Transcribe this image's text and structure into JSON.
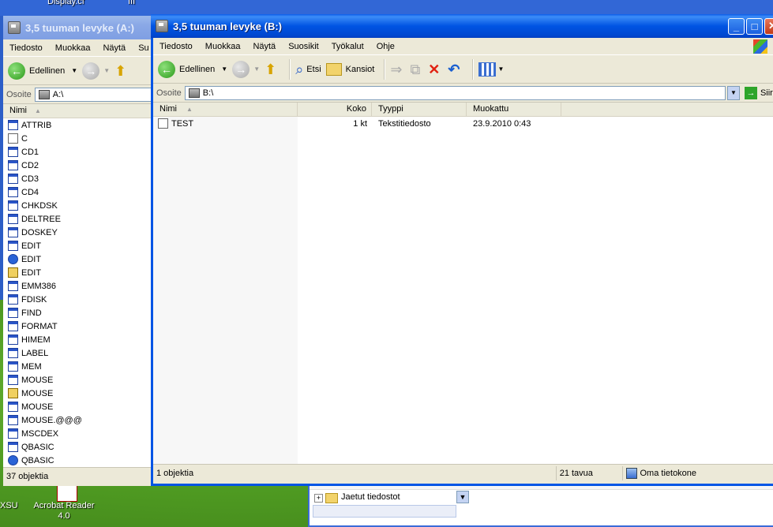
{
  "desktop": {
    "top_label_1": "Display.cf",
    "top_label_2": "III",
    "icon_label_1": "XSU",
    "icon_label_2": "Acrobat Reader 4.0"
  },
  "left_window": {
    "title": "3,5 tuuman levyke (A:)",
    "menu": [
      "Tiedosto",
      "Muokkaa",
      "Näytä",
      "Su"
    ],
    "back_label": "Edellinen",
    "address_label": "Osoite",
    "address_value": "A:\\",
    "column_name": "Nimi",
    "files": [
      {
        "name": "ATTRIB",
        "kind": "exe"
      },
      {
        "name": "C",
        "kind": "doc"
      },
      {
        "name": "CD1",
        "kind": "exe"
      },
      {
        "name": "CD2",
        "kind": "exe"
      },
      {
        "name": "CD3",
        "kind": "exe"
      },
      {
        "name": "CD4",
        "kind": "exe"
      },
      {
        "name": "CHKDSK",
        "kind": "exe"
      },
      {
        "name": "DELTREE",
        "kind": "exe"
      },
      {
        "name": "DOSKEY",
        "kind": "exe"
      },
      {
        "name": "EDIT",
        "kind": "exe"
      },
      {
        "name": "EDIT",
        "kind": "help"
      },
      {
        "name": "EDIT",
        "kind": "gear"
      },
      {
        "name": "EMM386",
        "kind": "exe"
      },
      {
        "name": "FDISK",
        "kind": "exe"
      },
      {
        "name": "FIND",
        "kind": "exe"
      },
      {
        "name": "FORMAT",
        "kind": "exe"
      },
      {
        "name": "HIMEM",
        "kind": "exe"
      },
      {
        "name": "LABEL",
        "kind": "exe"
      },
      {
        "name": "MEM",
        "kind": "exe"
      },
      {
        "name": "MOUSE",
        "kind": "exe"
      },
      {
        "name": "MOUSE",
        "kind": "gear"
      },
      {
        "name": "MOUSE",
        "kind": "exe"
      },
      {
        "name": "MOUSE.@@@",
        "kind": "exe"
      },
      {
        "name": "MSCDEX",
        "kind": "exe"
      },
      {
        "name": "QBASIC",
        "kind": "exe"
      },
      {
        "name": "QBASIC",
        "kind": "help"
      }
    ],
    "status": "37 objektia"
  },
  "right_window": {
    "title": "3,5 tuuman levyke (B:)",
    "menu": [
      "Tiedosto",
      "Muokkaa",
      "Näytä",
      "Suosikit",
      "Työkalut",
      "Ohje"
    ],
    "back_label": "Edellinen",
    "search_label": "Etsi",
    "folders_label": "Kansiot",
    "address_label": "Osoite",
    "address_value": "B:\\",
    "go_label": "Siirry",
    "columns": {
      "name": "Nimi",
      "size": "Koko",
      "type": "Tyyppi",
      "modified": "Muokattu"
    },
    "files": [
      {
        "name": "TEST",
        "size": "1 kt",
        "type": "Tekstitiedosto",
        "modified": "23.9.2010 0:43"
      }
    ],
    "status_count": "1 objektia",
    "status_size": "21 tavua",
    "status_location": "Oma tietokone"
  },
  "background_explorer": {
    "tree_item_1": "Jaetut tiedostot"
  }
}
